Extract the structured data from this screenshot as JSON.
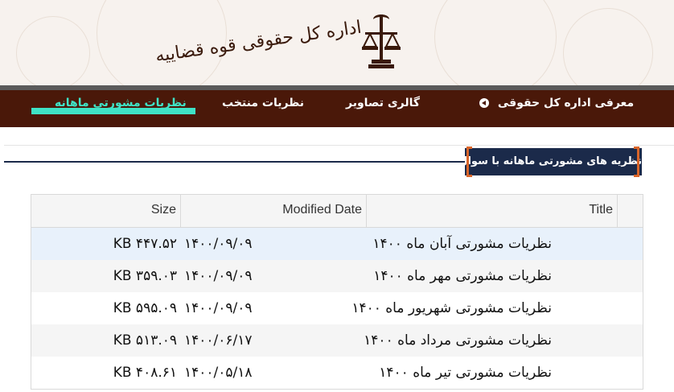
{
  "header": {
    "logo_text": "اداره کل حقوقی قوه قضاییه"
  },
  "nav": {
    "items": [
      {
        "label": "معرفی اداره کل حقوقی"
      },
      {
        "label": "گالری تصاویر"
      },
      {
        "label": "نظریات منتخب"
      },
      {
        "label": "نظریات مشورتی ماهانه"
      }
    ],
    "active_color": "#3fe3c6",
    "bar_color": "#4a1809"
  },
  "section": {
    "title": "نظریه های مشورتی ماهانه با سوال",
    "accent": "#d9652a",
    "bg": "#1b2a4a"
  },
  "table": {
    "headers": {
      "size": "Size",
      "modified": "Modified Date",
      "title": "Title"
    },
    "rows": [
      {
        "size": "KB ۴۴۷.۵۲",
        "modified": "۱۴۰۰/۰۹/۰۹",
        "title": "نظریات مشورتی آبان ماه ۱۴۰۰"
      },
      {
        "size": "KB ۳۵۹.۰۳",
        "modified": "۱۴۰۰/۰۹/۰۹",
        "title": "نظریات مشورتی مهر ماه ۱۴۰۰"
      },
      {
        "size": "KB ۵۹۵.۰۹",
        "modified": "۱۴۰۰/۰۹/۰۹",
        "title": "نظریات مشورتی شهریور ماه ۱۴۰۰"
      },
      {
        "size": "KB ۵۱۳.۰۹",
        "modified": "۱۴۰۰/۰۶/۱۷",
        "title": "نظریات مشورتی مرداد ماه ۱۴۰۰"
      },
      {
        "size": "KB ۴۰۸.۶۱",
        "modified": "۱۴۰۰/۰۵/۱۸",
        "title": "نظریات مشورتی تیر ماه ۱۴۰۰"
      }
    ]
  }
}
